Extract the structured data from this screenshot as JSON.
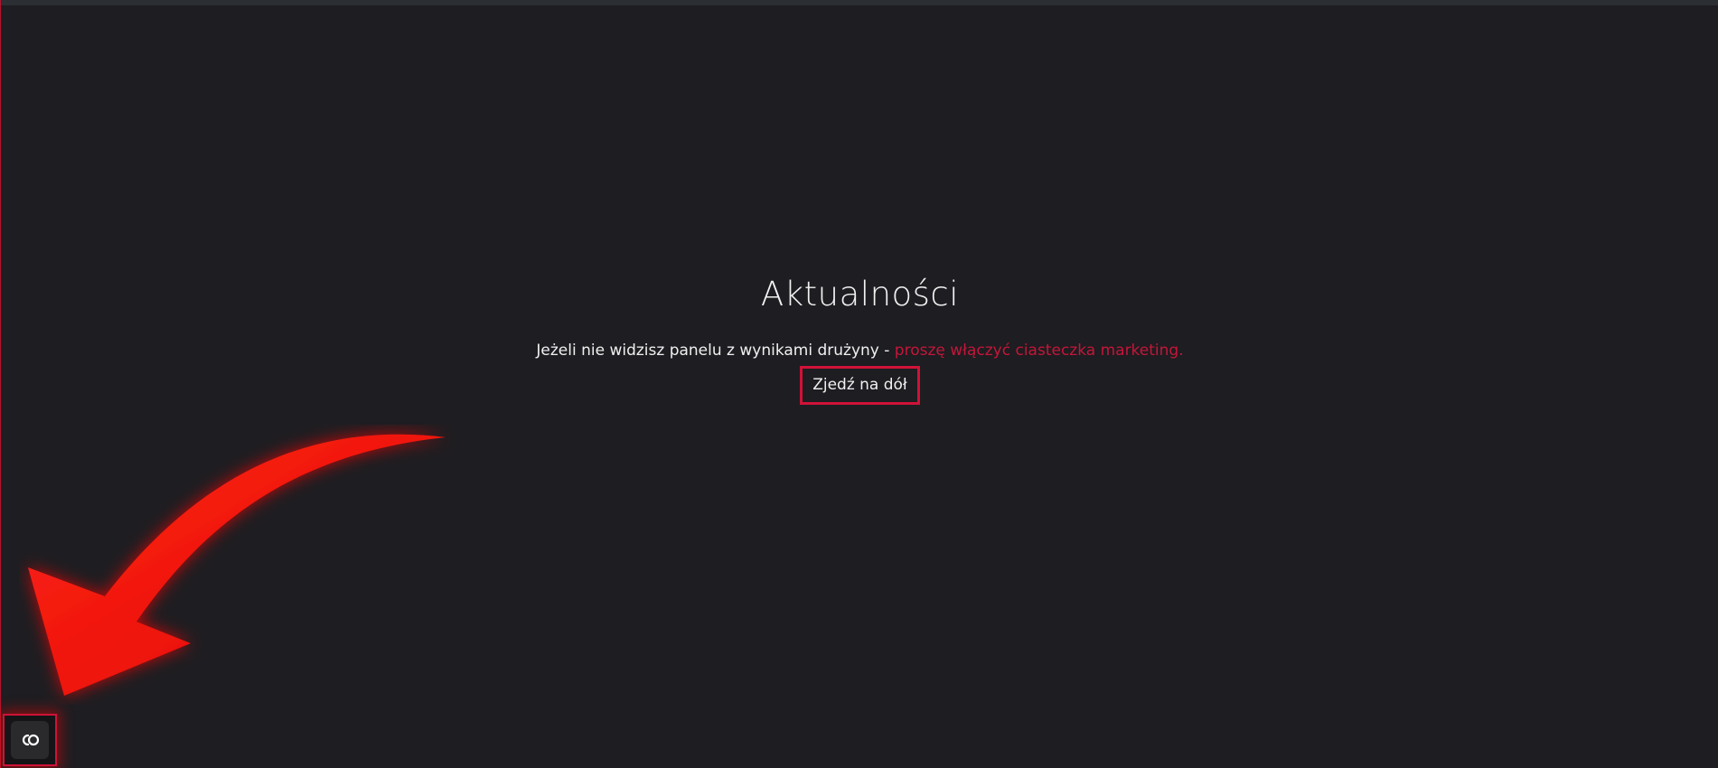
{
  "news": {
    "title": "Aktualności",
    "notice_text": "Jeżeli nie widzisz panelu z wynikami drużyny - ",
    "cookie_link": "proszę włączyć ciasteczka marketing.",
    "scroll_button": "Zjedź na dół"
  },
  "colors": {
    "background": "#1e1d21",
    "accent": "#d01238",
    "link": "#c4163a",
    "text": "#f0f0f0",
    "arrow": "#ff0000"
  },
  "icons": {
    "arrow": "arrow-pointing-down-left-icon",
    "cookie_settings": "cookie-consent-icon"
  }
}
